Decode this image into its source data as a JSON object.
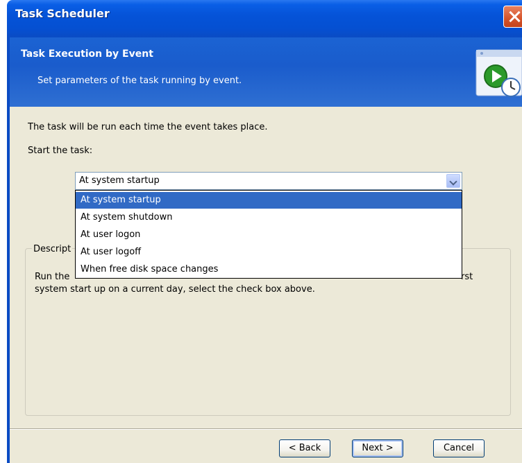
{
  "window": {
    "title": "Task Scheduler"
  },
  "header": {
    "title": "Task Execution by Event",
    "subtitle": "Set parameters of the task running by event.",
    "icon": "scheduler-clock-icon"
  },
  "content": {
    "intro": "The task will be run each time the event takes place.",
    "start_label": "Start the task:",
    "combo": {
      "selected": "At system startup",
      "options": [
        "At system startup",
        "At system shutdown",
        "At user logon",
        "At user logoff",
        "When free disk space changes"
      ]
    },
    "description": {
      "label": "Descript",
      "line1_start": "Run the",
      "line1_end": "rst",
      "line2": "system start up on a current day, select the check box above."
    }
  },
  "buttons": {
    "back": "< Back",
    "next": "Next >",
    "cancel": "Cancel"
  },
  "colors": {
    "title_blue": "#0553d8",
    "selection": "#316ac5",
    "dialog_bg": "#ece9d8"
  }
}
